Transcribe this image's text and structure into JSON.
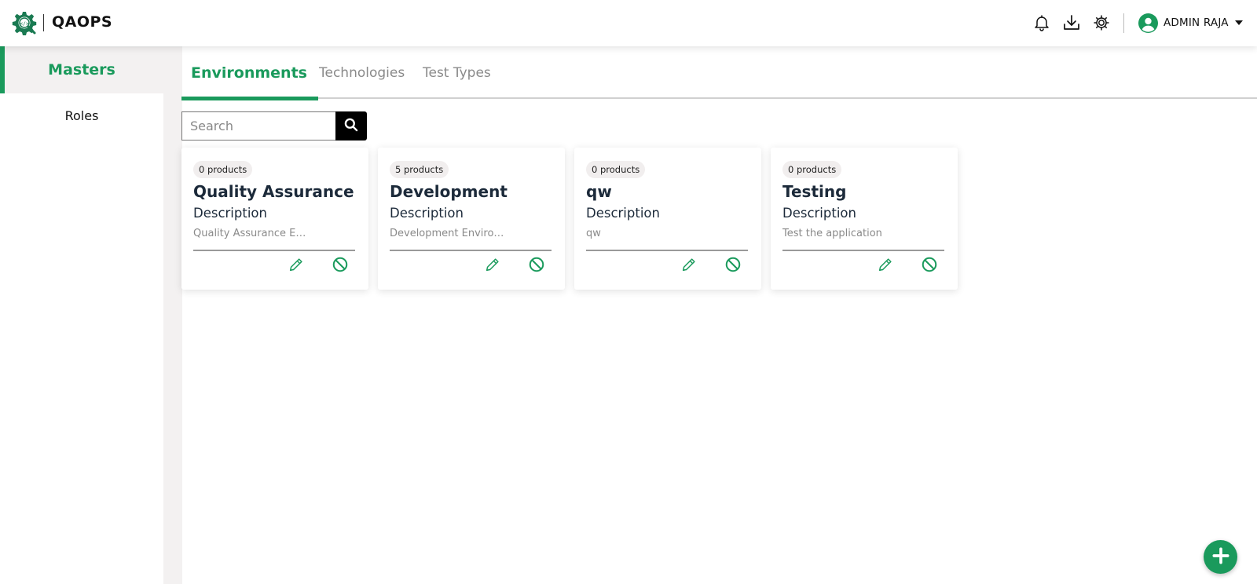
{
  "app": {
    "brand": "QAOPS"
  },
  "header": {
    "icons": [
      "bell-icon",
      "download-icon",
      "settings-icon"
    ],
    "user": {
      "name": "ADMIN RAJA",
      "icon": "user-circle-icon"
    }
  },
  "sidebar": {
    "items": [
      {
        "label": "Masters",
        "active": true
      },
      {
        "label": "Roles",
        "active": false
      }
    ]
  },
  "tabs": [
    {
      "label": "Environments",
      "active": true
    },
    {
      "label": "Technologies",
      "active": false
    },
    {
      "label": "Test Types",
      "active": false
    }
  ],
  "search": {
    "placeholder": "Search",
    "value": ""
  },
  "cards": [
    {
      "badge": "0 products",
      "title": "Quality Assurance",
      "description_label": "Description",
      "description": "Quality Assurance Environment"
    },
    {
      "badge": "5 products",
      "title": "Development",
      "description_label": "Description",
      "description": "Development Environment"
    },
    {
      "badge": "0 products",
      "title": "qw",
      "description_label": "Description",
      "description": "qw"
    },
    {
      "badge": "0 products",
      "title": "Testing",
      "description_label": "Description",
      "description": "Test the application"
    }
  ],
  "colors": {
    "accent": "#1a9a5c",
    "text_dark": "#1c2a3a",
    "muted": "#8a8a8a",
    "sidebar_bg": "#f3f1f1"
  },
  "fab": {
    "icon": "plus-icon"
  }
}
